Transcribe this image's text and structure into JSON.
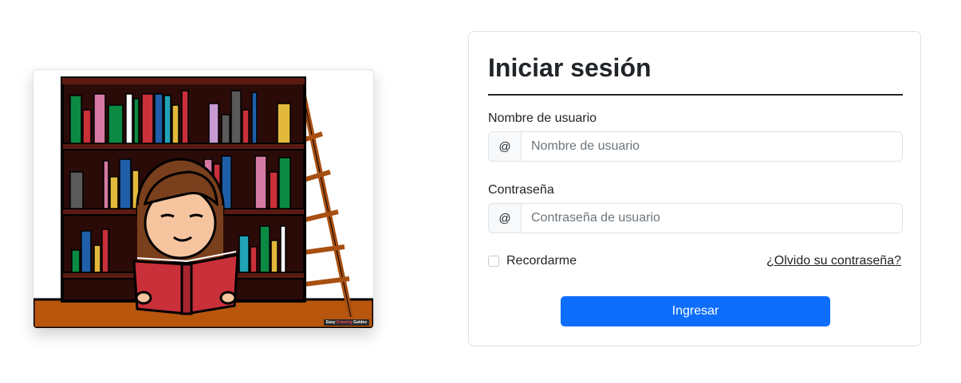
{
  "illustration": {
    "alt": "Niña leyendo un libro frente a una biblioteca",
    "watermark_prefix": "Easy ",
    "watermark_accent": "Drawing ",
    "watermark_suffix": "Guides"
  },
  "login": {
    "title": "Iniciar sesión",
    "username": {
      "label": "Nombre de usuario",
      "addon": "@",
      "placeholder": "Nombre de usuario",
      "value": ""
    },
    "password": {
      "label": "Contraseña",
      "addon": "@",
      "placeholder": "Contraseña de usuario",
      "value": ""
    },
    "remember_label": "Recordarme",
    "remember_checked": false,
    "forgot_label": "¿Olvido su contraseña?",
    "submit_label": "Ingresar"
  },
  "colors": {
    "primary": "#0d6efd",
    "border": "#dee2e6",
    "text": "#212529",
    "placeholder": "#6c757d"
  }
}
